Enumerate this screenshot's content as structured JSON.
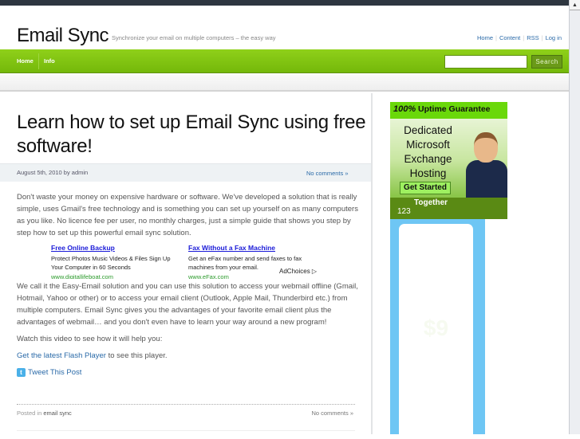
{
  "header": {
    "logo": "Email Sync",
    "tagline": "Synchronize your email on multiple computers – the easy way",
    "top_links": [
      "Home",
      "Content",
      "RSS",
      "Log in"
    ]
  },
  "nav": {
    "items": [
      "Home",
      "Info"
    ],
    "search_placeholder": "",
    "search_label": "Search"
  },
  "post": {
    "title": "Learn how to set up Email Sync using free software!",
    "date": "August 5th, 2010 by admin",
    "comments": "No comments »",
    "p1": "Don't waste your money on expensive hardware or software. We've developed a solution that is really simple, uses Gmail's free technology and is something you can set up yourself on as many computers as you like. No licence fee per user, no monthly charges, just a simple guide that shows you step by step how to set up this powerful email sync solution.",
    "ads": [
      {
        "title": "Free Online Backup",
        "text": "Protect Photos Music Videos & Files Sign Up Your Computer in 60 Seconds",
        "url": "www.digitallifeboat.com"
      },
      {
        "title": "Fax Without a Fax Machine",
        "text": "Get an eFax number and send faxes to fax machines from your email.",
        "url": "www.eFax.com"
      }
    ],
    "adchoices": "AdChoices ▷",
    "p2": "We call it the Easy-Email solution and you can use this solution to access your webmail offline (Gmail, Hotmail, Yahoo or other) or to access your email client (Outlook, Apple Mail, Thunderbird etc.) from multiple computers. Email Sync gives you the advantages of your favorite email client plus the advantages of webmail… and you don't even have to learn your way around a new program!",
    "p3": "Watch this video to see how it will help you:",
    "flash_link": "Get the latest Flash Player",
    "flash_rest": " to see this player.",
    "tweet": "Tweet This Post",
    "posted_in": "Posted in ",
    "category": "email sync",
    "footer_comments": "No comments »"
  },
  "sidebar": {
    "ad1": {
      "top_bold": "100%",
      "top": " Uptime Guarantee",
      "headline": "Dedicated Microsoft Exchange Hosting",
      "button": "Get Started",
      "tagline": "Together",
      "brand": "123"
    },
    "ad2": {
      "price": "$9"
    }
  }
}
